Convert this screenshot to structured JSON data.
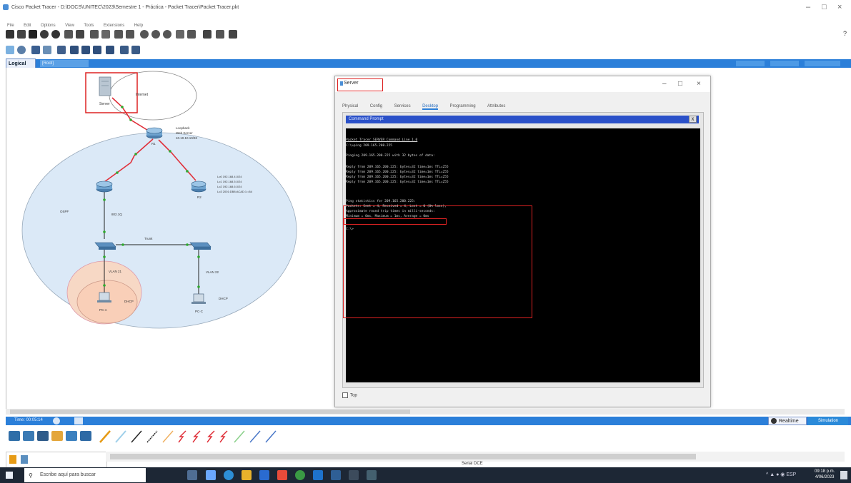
{
  "window": {
    "title": "Cisco Packet Tracer - D:\\DOCS\\UNITEC\\2023\\Semestre 1 - Práctica - Packet Tracer\\Packet Tracer.pkt",
    "menu": [
      "File",
      "Edit",
      "Options",
      "View",
      "Tools",
      "Extensions",
      "Help"
    ]
  },
  "workspace": {
    "logical_tab": "Logical",
    "breadcrumb": "[Root]"
  },
  "topology": {
    "server_label": "Server",
    "cloud_label": "Internet",
    "router_label": "R1",
    "router_note": [
      "Loopback",
      "Web Server",
      "10.10.10.10/32"
    ],
    "r2_label": "R2",
    "r2_note": [
      "Lo0 192.168.4.0/24",
      "Lo1 192.168.5.0/24",
      "Lo2 192.168.6.0/24",
      "Lo3 2001:DB8:ACAD:1::/64"
    ],
    "area_label": "OSPF",
    "link_label": "802.1Q",
    "trunk_label": "Trunk",
    "vlan_left": "VLAN 21",
    "vlan_right": "VLAN 22",
    "pc_left_label": "PC-A",
    "pc_right_label": "PC-C",
    "dhcp_label": "DHCP"
  },
  "dialog": {
    "title": "Server",
    "tabs": [
      "Physical",
      "Config",
      "Services",
      "Desktop",
      "Programming",
      "Attributes"
    ],
    "active_tab": "Desktop",
    "panel_title": "Command Prompt",
    "close": "X",
    "top_checkbox": "Top",
    "terminal": [
      "Packet Tracer SERVER Command Line 1.0",
      "C:\\>ping 209.165.200.225",
      "",
      "Pinging 209.165.200.225 with 32 bytes of data:",
      "",
      "Reply from 209.165.200.225: bytes=32 time=1ms TTL=255",
      "Reply from 209.165.200.225: bytes=32 time=1ms TTL=255",
      "Reply from 209.165.200.225: bytes=32 time=1ms TTL=255",
      "Reply from 209.165.200.225: bytes=32 time=1ms TTL=255",
      "",
      "Ping statistics for 209.165.200.225:",
      "    Packets: Sent = 4, Received = 4, Lost = 0 (0% loss),",
      "Approximate round trip times in milli-seconds:",
      "    Minimum = 0ms, Maximum = 1ms, Average = 0ms",
      "",
      "C:\\>"
    ]
  },
  "bottom": {
    "time_label": "Time: 00:05:14",
    "realtime": "Realtime",
    "simulation": "Simulation",
    "connection_label": "Serial DCE"
  },
  "taskbar": {
    "search_placeholder": "Escribe aquí para buscar",
    "time": "09:18 p.m.",
    "date": "4/06/2023"
  },
  "colors": {
    "accent_blue": "#2b7fd9",
    "highlight_red": "#d22222",
    "serial_link": "#e0303a",
    "ethernet_link": "#222222",
    "ospf_area": "#dbe9f7"
  }
}
